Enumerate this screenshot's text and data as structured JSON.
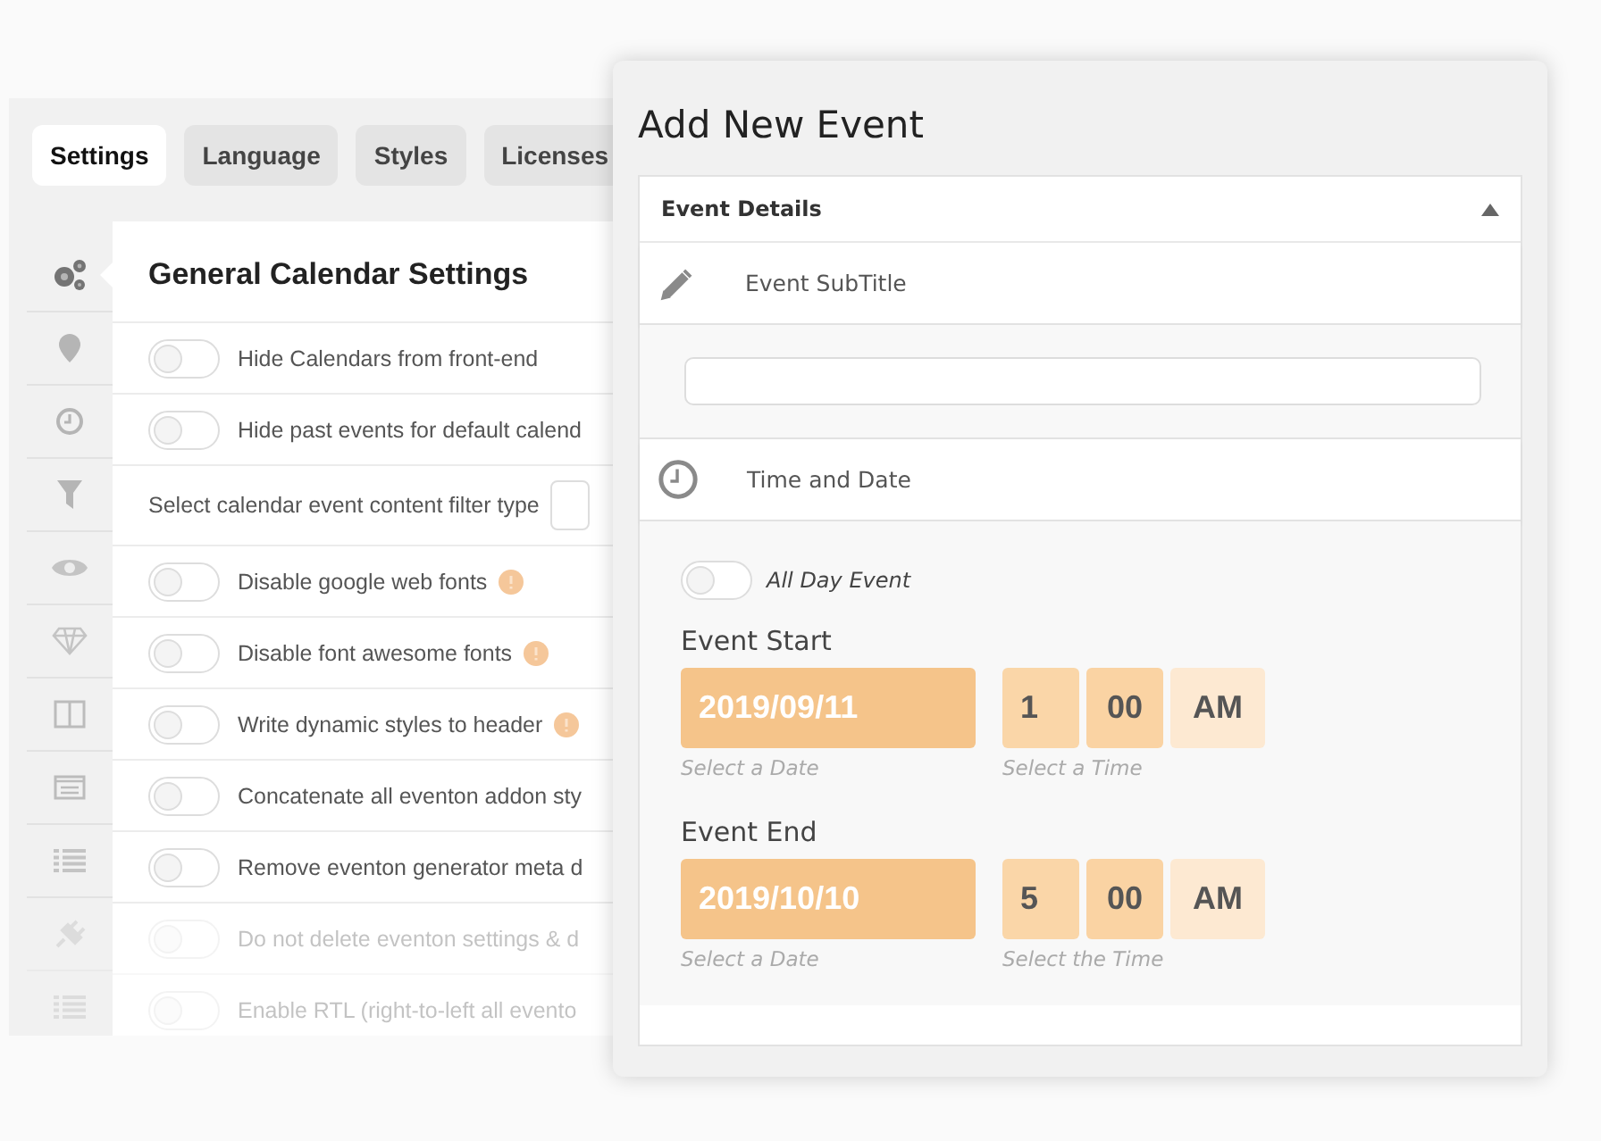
{
  "settings_tabs": [
    {
      "label": "Settings",
      "selected": true
    },
    {
      "label": "Language",
      "selected": false
    },
    {
      "label": "Styles",
      "selected": false
    },
    {
      "label": "Licenses",
      "selected": false
    }
  ],
  "sidebar": {
    "items": [
      {
        "kind": "gears",
        "selected": true
      },
      {
        "kind": "pin",
        "selected": false
      },
      {
        "kind": "clock",
        "selected": false
      },
      {
        "kind": "filter",
        "selected": false
      },
      {
        "kind": "eye",
        "selected": false
      },
      {
        "kind": "diamond",
        "selected": false
      },
      {
        "kind": "columns",
        "selected": false
      },
      {
        "kind": "card",
        "selected": false
      },
      {
        "kind": "list",
        "selected": false
      },
      {
        "kind": "plug",
        "selected": false
      },
      {
        "kind": "list",
        "selected": false
      }
    ]
  },
  "general_settings": {
    "title": "General Calendar Settings",
    "rows": [
      {
        "kind": "toggle",
        "label": "Hide Calendars from front-end",
        "on": false,
        "alert": false,
        "faded": false
      },
      {
        "kind": "toggle",
        "label": "Hide past events for default calend",
        "on": false,
        "alert": false,
        "faded": false
      },
      {
        "kind": "select",
        "label": "Select calendar event content filter type",
        "faded": false
      },
      {
        "kind": "toggle",
        "label": "Disable google web fonts",
        "on": false,
        "alert": true,
        "faded": false
      },
      {
        "kind": "toggle",
        "label": "Disable font awesome fonts",
        "on": false,
        "alert": true,
        "faded": false
      },
      {
        "kind": "toggle",
        "label": "Write dynamic styles to header",
        "on": false,
        "alert": true,
        "faded": false
      },
      {
        "kind": "toggle",
        "label": "Concatenate all eventon addon sty",
        "on": false,
        "alert": false,
        "faded": false
      },
      {
        "kind": "toggle",
        "label": "Remove eventon generator meta d",
        "on": false,
        "alert": false,
        "faded": false
      },
      {
        "kind": "toggle",
        "label": "Do not delete eventon settings & d",
        "on": false,
        "alert": false,
        "faded": true
      },
      {
        "kind": "toggle",
        "label": "Enable RTL (right-to-left all evento",
        "on": false,
        "alert": false,
        "faded": true
      }
    ]
  },
  "dialog": {
    "title": "Add New Event",
    "section": {
      "title": "Event Details",
      "expanded": true
    },
    "subtitle": {
      "label": "Event SubTitle"
    },
    "time_section": {
      "label": "Time and Date"
    },
    "all_day": {
      "label": "All Day Event",
      "on": false
    },
    "start": {
      "label": "Event Start",
      "date": "2019/09/11",
      "date_hint": "Select a Date",
      "hour": "1",
      "minute": "00",
      "ampm": "AM",
      "time_hint": "Select a Time"
    },
    "end": {
      "label": "Event End",
      "date": "2019/10/10",
      "date_hint": "Select a Date",
      "hour": "5",
      "minute": "00",
      "ampm": "AM",
      "time_hint": "Select the Time"
    }
  }
}
